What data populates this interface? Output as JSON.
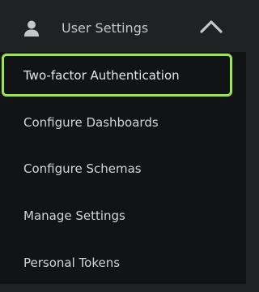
{
  "header": {
    "title": "User Settings",
    "icon": "user-icon",
    "toggle_icon": "chevron-up-icon"
  },
  "submenu": {
    "items": [
      {
        "label": "Two-factor Authentication",
        "active": true
      },
      {
        "label": "Configure Dashboards",
        "active": false
      },
      {
        "label": "Configure Schemas",
        "active": false
      },
      {
        "label": "Manage Settings",
        "active": false
      },
      {
        "label": "Personal Tokens",
        "active": false
      }
    ]
  },
  "colors": {
    "background": "#1f2123",
    "submenu_background": "#121314",
    "focus_ring": "#a4e05a",
    "text": "#d2d4d7"
  }
}
